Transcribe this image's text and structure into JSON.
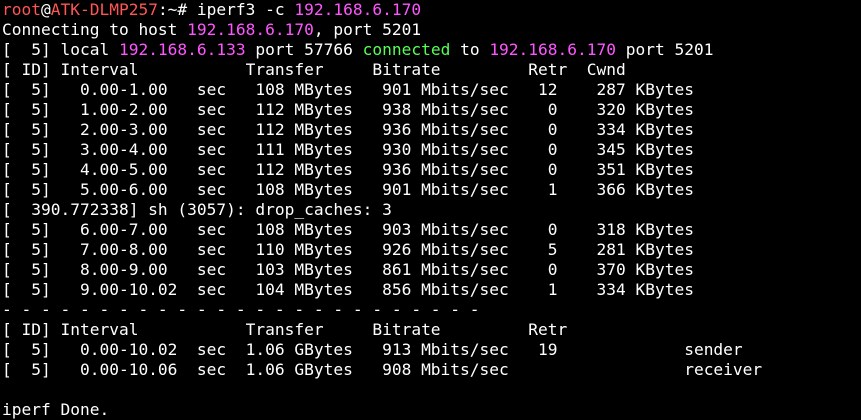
{
  "prompt": {
    "user": "root",
    "at": "@",
    "host": "ATK-DLMP257",
    "suffix": ":~# ",
    "command": "iperf3 -c ",
    "target": "192.168.6.170"
  },
  "connecting": {
    "prefix": "Connecting to host ",
    "host": "192.168.6.170",
    "suffix": ", port 5201"
  },
  "connected": {
    "prefix": "[  5] local ",
    "local_ip": "192.168.6.133",
    "mid": " port 57766 ",
    "word": "connected",
    "to": " to ",
    "remote_ip": "192.168.6.170",
    "suffix": " port 5201"
  },
  "header1": "[ ID] Interval           Transfer     Bitrate         Retr  Cwnd",
  "rows_a": [
    "[  5]   0.00-1.00   sec   108 MBytes   901 Mbits/sec   12    287 KBytes",
    "[  5]   1.00-2.00   sec   112 MBytes   938 Mbits/sec    0    320 KBytes",
    "[  5]   2.00-3.00   sec   112 MBytes   936 Mbits/sec    0    334 KBytes",
    "[  5]   3.00-4.00   sec   111 MBytes   930 Mbits/sec    0    345 KBytes",
    "[  5]   4.00-5.00   sec   112 MBytes   936 Mbits/sec    0    351 KBytes",
    "[  5]   5.00-6.00   sec   108 MBytes   901 Mbits/sec    1    366 KBytes"
  ],
  "kernel_msg": "[  390.772338] sh (3057): drop_caches: 3",
  "rows_b": [
    "[  5]   6.00-7.00   sec   108 MBytes   903 Mbits/sec    0    318 KBytes",
    "[  5]   7.00-8.00   sec   110 MBytes   926 Mbits/sec    5    281 KBytes",
    "[  5]   8.00-9.00   sec   103 MBytes   861 Mbits/sec    0    370 KBytes",
    "[  5]   9.00-10.02  sec   104 MBytes   856 Mbits/sec    1    334 KBytes"
  ],
  "separator": "- - - - - - - - - - - - - - - - - - - - - - - - -",
  "header2": "[ ID] Interval           Transfer     Bitrate         Retr",
  "summary": [
    "[  5]   0.00-10.02  sec  1.06 GBytes   913 Mbits/sec   19             sender",
    "[  5]   0.00-10.06  sec  1.06 GBytes   908 Mbits/sec                  receiver"
  ],
  "blank": "",
  "done": "iperf Done.",
  "colors": {
    "red": "#ff5555",
    "magenta": "#ff55ff",
    "green": "#55ff55",
    "text": "#ffffff",
    "background": "#000000"
  }
}
